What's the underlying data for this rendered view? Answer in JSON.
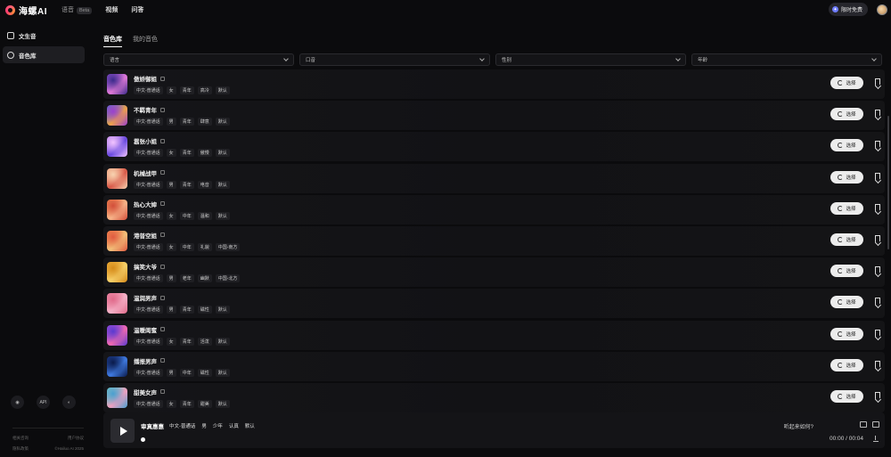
{
  "app": {
    "logo_text": "海螺AI",
    "colors": {
      "accent": "#6e7cff",
      "brand": "#ff5a7a"
    }
  },
  "nav": {
    "items": [
      {
        "label": "语音",
        "badge": "Beta",
        "active": false
      },
      {
        "label": "视频"
      },
      {
        "label": "问答"
      }
    ]
  },
  "topright": {
    "free_label": "限时免费",
    "free_icon": "gift-icon"
  },
  "sidebar": {
    "items": [
      {
        "label": "文生音",
        "icon": "text-to-audio-icon"
      },
      {
        "label": "音色库",
        "icon": "voice-library-icon",
        "active": true
      }
    ],
    "bottom_icons": [
      {
        "name": "discord-icon",
        "text": ""
      },
      {
        "name": "api-icon",
        "text": "API"
      },
      {
        "name": "theme-icon",
        "text": ""
      }
    ],
    "links": [
      {
        "left": "相关咨询",
        "right": "用户协议"
      },
      {
        "left": "隐私政策",
        "right": "©Hailuo AI 2025"
      }
    ]
  },
  "tabs": [
    {
      "label": "音色库",
      "active": true
    },
    {
      "label": "我的音色"
    }
  ],
  "filters": [
    {
      "label": "语言"
    },
    {
      "label": "口音"
    },
    {
      "label": "性别"
    },
    {
      "label": "年龄"
    }
  ],
  "select_label": "选择",
  "voices": [
    {
      "name": "傲娇御姐",
      "tags": [
        "中文-普通话",
        "女",
        "青年",
        "高冷",
        "默认"
      ],
      "thumb": [
        "#8a4fd6",
        "#e07ad6",
        "#3b2a8a"
      ]
    },
    {
      "name": "不羁青年",
      "tags": [
        "中文-普通话",
        "男",
        "青年",
        "肆意",
        "默认"
      ],
      "thumb": [
        "#3d6fd8",
        "#f0a24a",
        "#9a3fd0"
      ]
    },
    {
      "name": "嚣张小姐",
      "tags": [
        "中文-普通话",
        "女",
        "青年",
        "傲慢",
        "默认"
      ],
      "thumb": [
        "#b77ae6",
        "#6a4be0",
        "#f2c4ff"
      ]
    },
    {
      "name": "机械战甲",
      "tags": [
        "中文-普通话",
        "男",
        "青年",
        "电音",
        "默认"
      ],
      "thumb": [
        "#f3a07a",
        "#d85a4a",
        "#f7d3b0"
      ]
    },
    {
      "name": "热心大婶",
      "tags": [
        "中文-普通话",
        "女",
        "中年",
        "温和",
        "默认"
      ],
      "thumb": [
        "#f0894a",
        "#f7b48a",
        "#d24e3a"
      ]
    },
    {
      "name": "港普空姐",
      "tags": [
        "中文-普通话",
        "女",
        "中年",
        "礼貌",
        "中国-南方"
      ],
      "thumb": [
        "#f58a4a",
        "#f2c07a",
        "#e05a40"
      ]
    },
    {
      "name": "搞笑大爷",
      "tags": [
        "中文-普通话",
        "男",
        "老年",
        "幽默",
        "中国-北方"
      ],
      "thumb": [
        "#f3b33a",
        "#f7d06a",
        "#d48a1a"
      ]
    },
    {
      "name": "温润男声",
      "tags": [
        "中文-普通话",
        "男",
        "青年",
        "磁性",
        "默认"
      ],
      "thumb": [
        "#f08aa8",
        "#f5b2c8",
        "#e06a8a"
      ]
    },
    {
      "name": "温暖闺蜜",
      "tags": [
        "中文-普通话",
        "女",
        "青年",
        "活泼",
        "默认"
      ],
      "thumb": [
        "#9a4ae0",
        "#f06ab0",
        "#5a3ad0"
      ]
    },
    {
      "name": "播报男声",
      "tags": [
        "中文-普通话",
        "男",
        "中年",
        "磁性",
        "默认"
      ],
      "thumb": [
        "#1e3a8a",
        "#3f7ae0",
        "#0a1a4a"
      ]
    },
    {
      "name": "甜美女声",
      "tags": [
        "中文-普通话",
        "女",
        "青年",
        "甜美",
        "默认"
      ],
      "thumb": [
        "#6ad0c0",
        "#f0a0c0",
        "#4aa0d0"
      ]
    }
  ],
  "player": {
    "name": "审真惠惠",
    "tags": [
      "中文-普通话",
      "男",
      "少年",
      "认真",
      "默认"
    ],
    "feedback": "听起来如何?",
    "time": "00:00 / 00:04",
    "progress": 0
  }
}
